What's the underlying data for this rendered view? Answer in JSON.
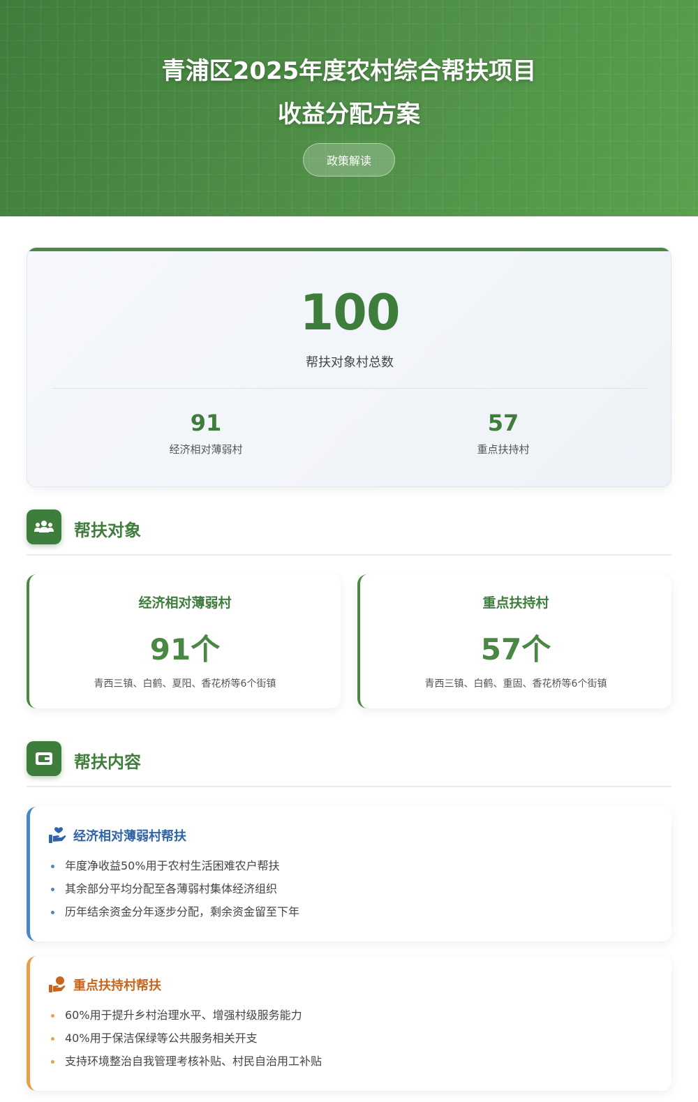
{
  "hero": {
    "title_line1": "青浦区2025年度农村综合帮扶项目",
    "title_line2": "收益分配方案",
    "button_label": "政策解读"
  },
  "stats": {
    "total_value": "100",
    "total_label": "帮扶对象村总数",
    "items": [
      {
        "value": "91",
        "label": "经济相对薄弱村"
      },
      {
        "value": "57",
        "label": "重点扶持村"
      }
    ]
  },
  "section_targets": {
    "title": "帮扶对象",
    "icon": "people-group-icon",
    "cards": [
      {
        "title": "经济相对薄弱村",
        "value": "91个",
        "desc": "青西三镇、白鹤、夏阳、香花桥等6个街镇"
      },
      {
        "title": "重点扶持村",
        "value": "57个",
        "desc": "青西三镇、白鹤、重固、香花桥等6个街镇"
      }
    ]
  },
  "section_content": {
    "title": "帮扶内容",
    "icon": "wallet-icon",
    "cards": [
      {
        "title": "经济相对薄弱村帮扶",
        "icon": "hand-holding-heart-icon",
        "accent": "#4a86c5",
        "items": [
          "年度净收益50%用于农村生活困难农户帮扶",
          "其余部分平均分配至各薄弱村集体经济组织",
          "历年结余资金分年逐步分配，剩余资金留至下年"
        ]
      },
      {
        "title": "重点扶持村帮扶",
        "icon": "hand-holding-medical-icon",
        "accent": "#e4a04a",
        "items": [
          "60%用于提升乡村治理水平、增强村级服务能力",
          "40%用于保洁保绿等公共服务相关开支",
          "支持环境整治自我管理考核补贴、村民自治用工补贴"
        ]
      }
    ]
  },
  "colors": {
    "primary_green": "#3f7d3c",
    "blue_accent": "#4a86c5",
    "orange_accent": "#e4a04a"
  }
}
